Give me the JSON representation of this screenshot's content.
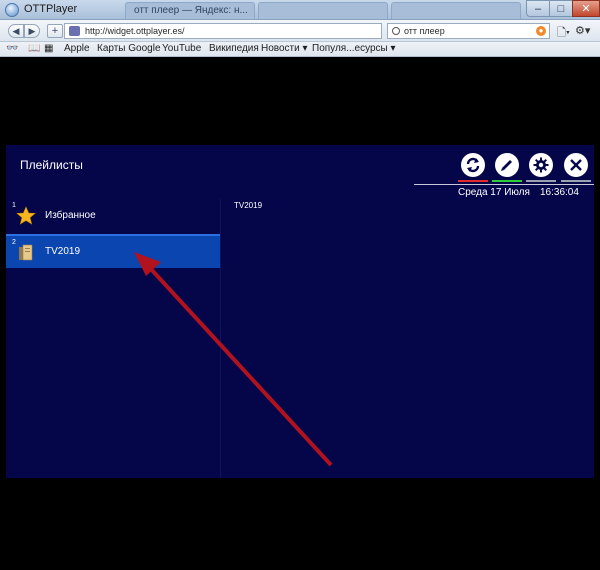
{
  "browser": {
    "window_title": "OTTPlayer",
    "tabs": [
      "отт плеер — Яндекс: н...",
      "",
      ""
    ],
    "url": "http://widget.ottplayer.es/",
    "search_value": "отт плеер",
    "bookmarks": [
      "Apple",
      "Карты Google",
      "YouTube",
      "Википедия",
      "Новости ▾",
      "Популя...есурсы ▾"
    ]
  },
  "app": {
    "title": "Плейлисты",
    "date": "Среда 17 Июля",
    "time": "16:36:04",
    "playlists": [
      {
        "number": "1",
        "label": "Избранное",
        "icon": "star-icon"
      },
      {
        "number": "2",
        "label": "TV2019",
        "icon": "playlist-file-icon"
      }
    ],
    "selected_playlist_title": "TV2019",
    "toolbar_buttons": [
      "refresh-icon",
      "edit-icon",
      "settings-icon",
      "close-icon"
    ],
    "underline_colors": [
      "#e22a2a",
      "#2ecc3a",
      "#9aa0b0",
      "#9aa0b0"
    ]
  },
  "colors": {
    "app_background": "#05054a",
    "selected_row": "#0a45b0",
    "arrow": "#b0121e"
  }
}
